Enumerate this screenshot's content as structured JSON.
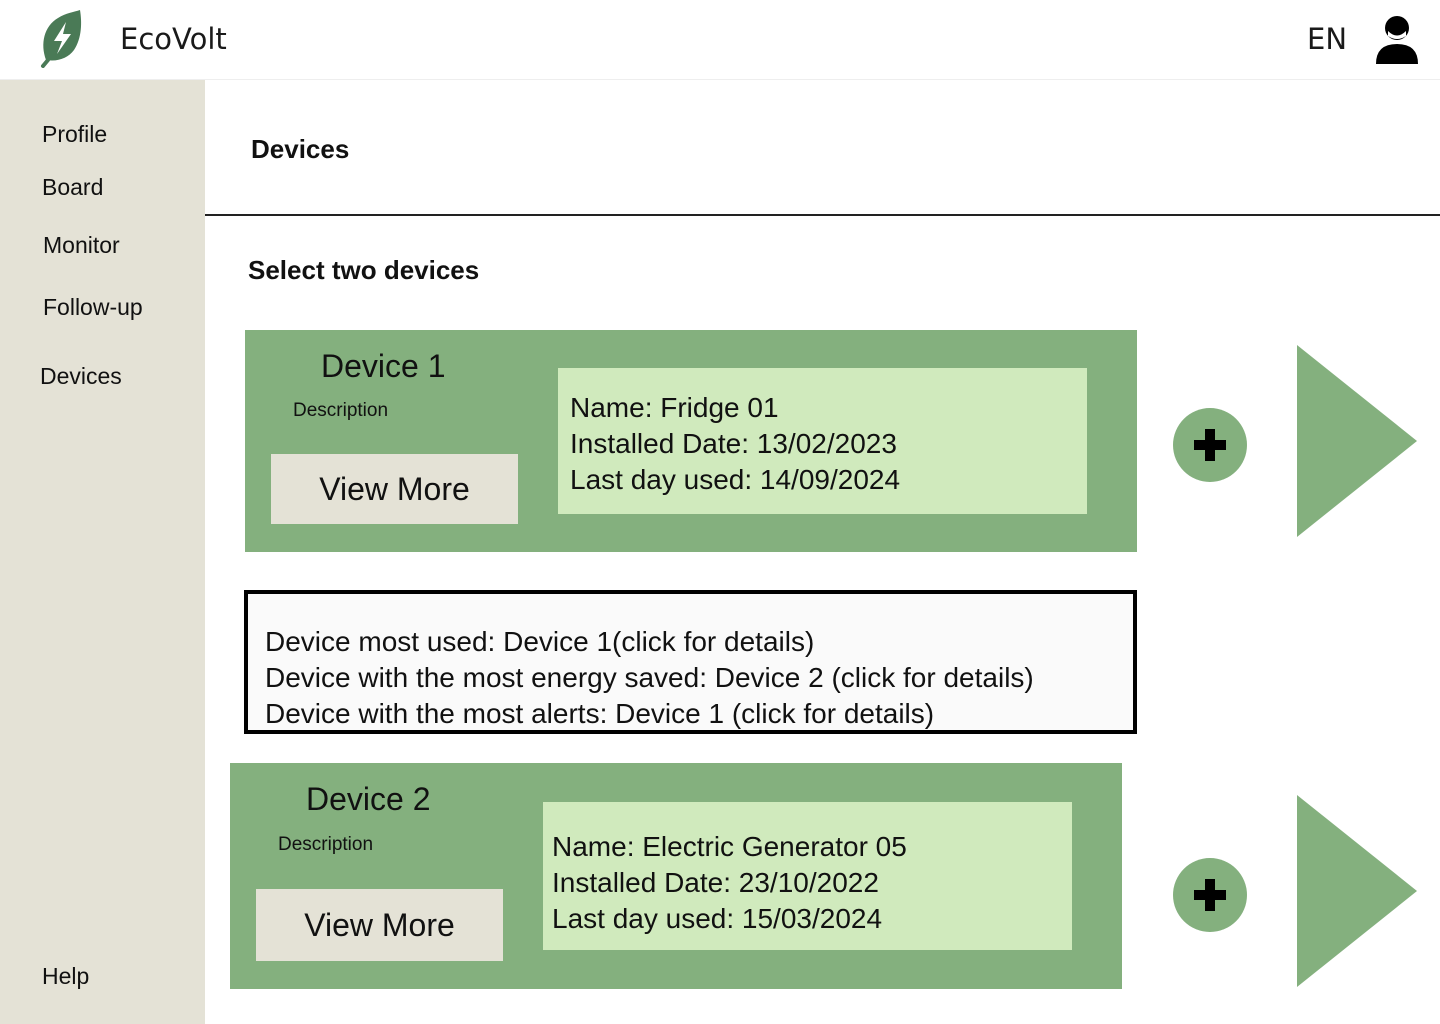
{
  "header": {
    "app_name": "EcoVolt",
    "language": "EN",
    "logo_icon": "leaf-bolt-icon",
    "user_icon": "user-icon",
    "brand_color": "#4a7a56"
  },
  "sidebar": {
    "items": [
      {
        "label": "Profile"
      },
      {
        "label": "Board"
      },
      {
        "label": "Monitor"
      },
      {
        "label": "Follow-up"
      },
      {
        "label": "Devices"
      }
    ],
    "help_label": "Help"
  },
  "main": {
    "title": "Devices",
    "section_title": "Select two devices",
    "devices": [
      {
        "title": "Device 1",
        "description_label": "Description",
        "view_more_label": "View More",
        "name": "Name: Fridge 01",
        "installed": "Installed Date: 13/02/2023",
        "last_used": "Last day used: 14/09/2024"
      },
      {
        "title": "Device 2",
        "description_label": "Description",
        "view_more_label": "View More",
        "name": "Name: Electric Generator 05",
        "installed": "Installed Date: 23/10/2022",
        "last_used": "Last day used: 15/03/2024"
      }
    ],
    "summary": {
      "most_used": "Device most used: Device 1(click for details)",
      "most_energy_saved": "Device with the most energy saved: Device 2 (click for details)",
      "most_alerts": "Device with the most alerts: Device 1 (click for details)"
    }
  },
  "colors": {
    "card_green": "#84b07e",
    "info_green": "#d0eabd",
    "sidebar_beige": "#e4e2d6"
  }
}
